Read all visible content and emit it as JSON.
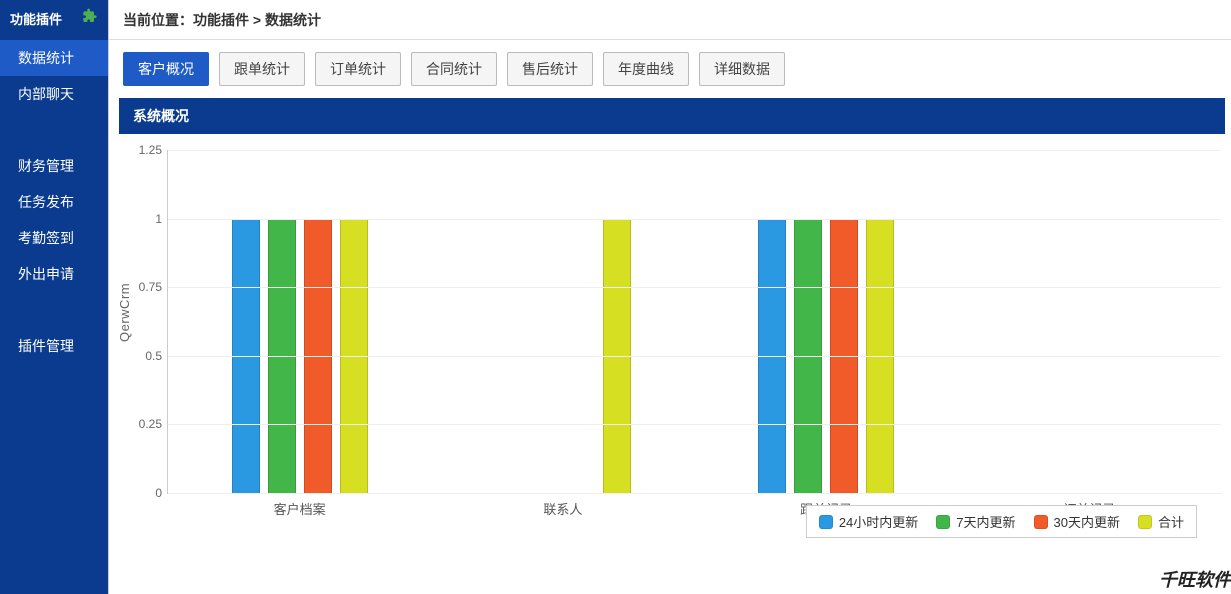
{
  "sidebar": {
    "header": "功能插件",
    "items": [
      {
        "label": "数据统计",
        "active": true
      },
      {
        "label": "内部聊天",
        "active": false
      },
      {
        "label": "财务管理",
        "active": false
      },
      {
        "label": "任务发布",
        "active": false
      },
      {
        "label": "考勤签到",
        "active": false
      },
      {
        "label": "外出申请",
        "active": false
      },
      {
        "label": "插件管理",
        "active": false
      }
    ]
  },
  "breadcrumb": {
    "prefix": "当前位置：",
    "path": "功能插件 > 数据统计"
  },
  "tabs": [
    {
      "label": "客户概况",
      "active": true
    },
    {
      "label": "跟单统计",
      "active": false
    },
    {
      "label": "订单统计",
      "active": false
    },
    {
      "label": "合同统计",
      "active": false
    },
    {
      "label": "售后统计",
      "active": false
    },
    {
      "label": "年度曲线",
      "active": false
    },
    {
      "label": "详细数据",
      "active": false
    }
  ],
  "panel": {
    "title": "系统概况"
  },
  "footer": {
    "brand": "千旺软件"
  },
  "chart_data": {
    "type": "bar",
    "ylabel": "QerwCrm",
    "ylim": [
      0,
      1.25
    ],
    "yticks": [
      0,
      0.25,
      0.5,
      0.75,
      1,
      1.25
    ],
    "categories": [
      "客户档案",
      "联系人",
      "跟单记录",
      "订单记录"
    ],
    "series": [
      {
        "name": "24小时内更新",
        "color": "#2b99e2",
        "values": [
          1,
          0,
          1,
          0
        ]
      },
      {
        "name": "7天内更新",
        "color": "#43b649",
        "values": [
          1,
          0,
          1,
          0
        ]
      },
      {
        "name": "30天内更新",
        "color": "#f15a29",
        "values": [
          1,
          0,
          1,
          0
        ]
      },
      {
        "name": "合计",
        "color": "#d7df23",
        "values": [
          1,
          1,
          1,
          0
        ]
      }
    ]
  }
}
